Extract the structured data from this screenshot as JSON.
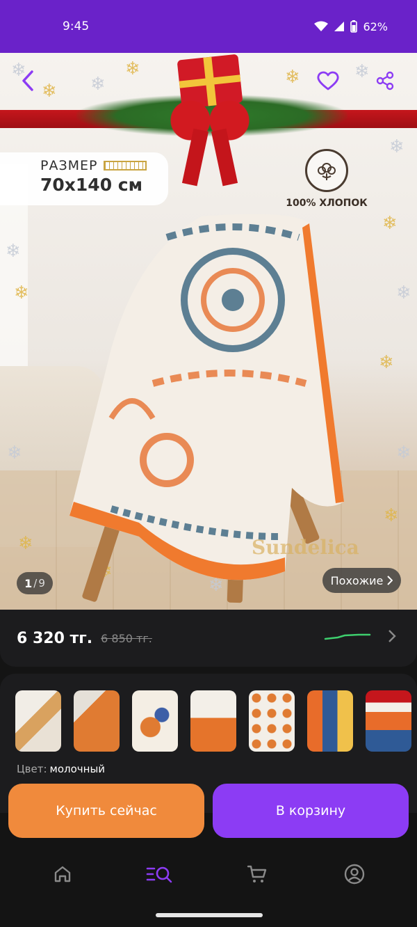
{
  "status_bar": {
    "time": "9:45",
    "battery": "62%"
  },
  "product": {
    "size_label": "РАЗМЕР",
    "size_value": "70x140 см",
    "material_badge": "100% ХЛОПОК",
    "watermark": "Sundelica",
    "image_counter": {
      "current": "1",
      "total": "9"
    },
    "similar_label": "Похожие"
  },
  "price": {
    "current": "6 320 тг.",
    "old": "6 850 тг.",
    "trend_color": "#3ecf6e"
  },
  "variants": {
    "color_label": "Цвет:",
    "color_value": "молочный",
    "thumbnails": [
      {
        "name": "variant-milk"
      },
      {
        "name": "variant-orange"
      },
      {
        "name": "variant-floral"
      },
      {
        "name": "variant-orange-set"
      },
      {
        "name": "variant-circles"
      },
      {
        "name": "variant-blue-orange"
      },
      {
        "name": "variant-gift-set"
      }
    ]
  },
  "actions": {
    "buy_now": "Купить сейчас",
    "add_to_cart": "В корзину"
  },
  "nav": {
    "items": [
      "home-icon",
      "catalog-search-icon",
      "cart-icon",
      "profile-icon"
    ],
    "active": "catalog-search-icon"
  },
  "colors": {
    "accent": "#8c3cf4",
    "buy_now": "#f08a3c",
    "status_bar": "#6a22c9",
    "heart": "#8c3cf4"
  }
}
